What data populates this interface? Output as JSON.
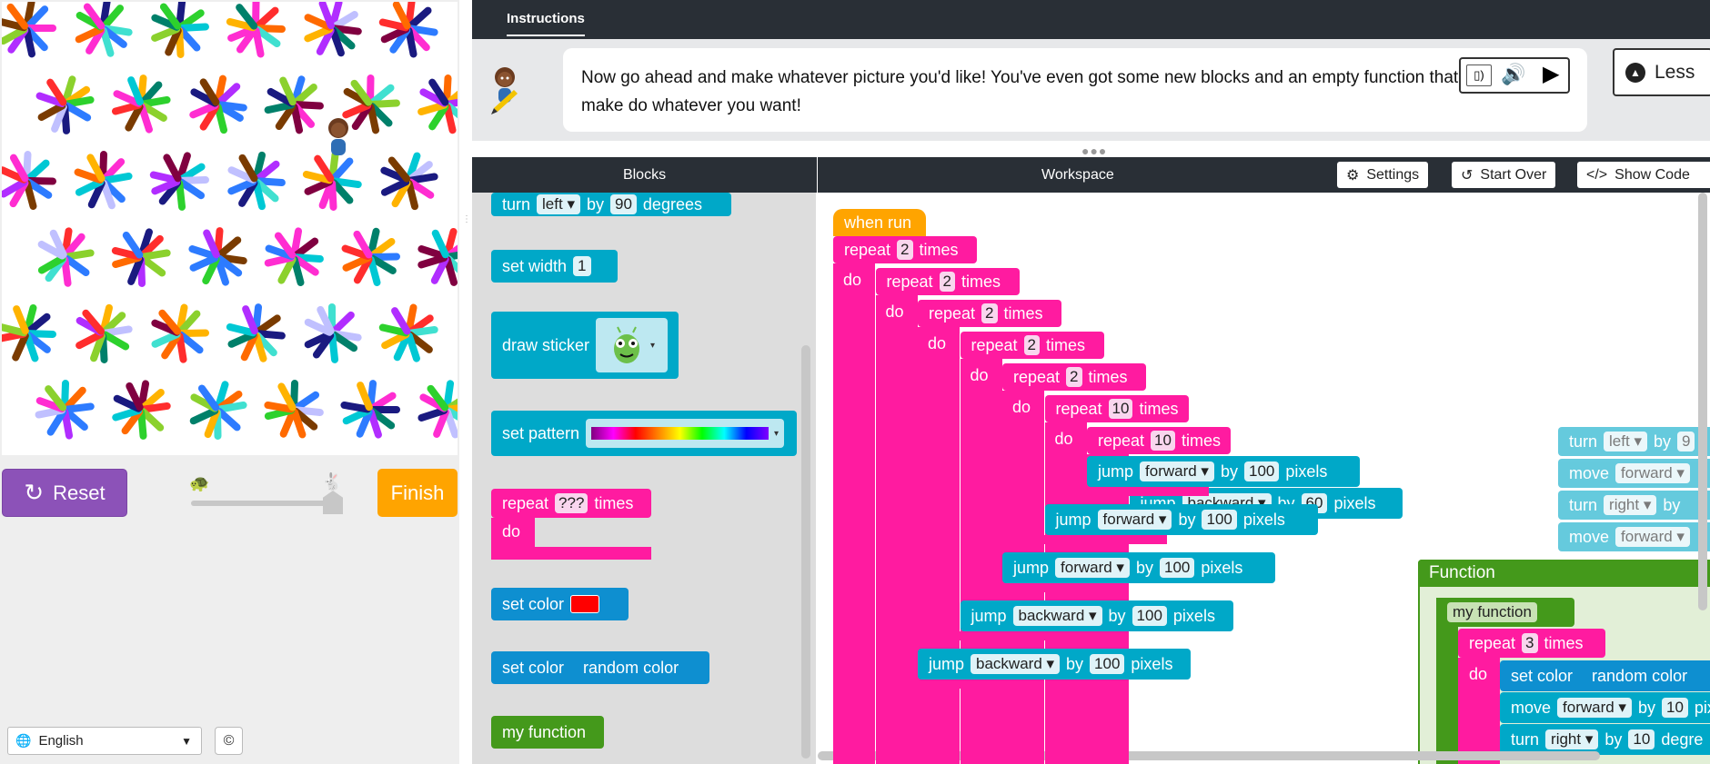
{
  "left_panel": {
    "reset_label": "Reset",
    "finish_label": "Finish",
    "language": "English",
    "speed_slider_value": 1.0
  },
  "instructions": {
    "tab_label": "Instructions",
    "text": "Now go ahead and make whatever picture you'd like! You've even got some new blocks and an empty function that you can make do whatever you want!",
    "less_label": "Less"
  },
  "headers": {
    "blocks": "Blocks",
    "workspace": "Workspace",
    "settings": "Settings",
    "start_over": "Start Over",
    "show_code": "Show Code"
  },
  "toolbox": {
    "turn": {
      "kw": "turn",
      "dir": "left",
      "by": "by",
      "value": "90",
      "unit": "degrees"
    },
    "set_width": {
      "kw": "set width",
      "value": "1"
    },
    "draw_sticker": {
      "kw": "draw sticker"
    },
    "set_pattern": {
      "kw": "set pattern"
    },
    "repeat": {
      "kw": "repeat",
      "value": "???",
      "unit": "times",
      "do": "do"
    },
    "set_color": {
      "kw": "set color",
      "color": "#ff0000"
    },
    "set_color_random": {
      "kw": "set color",
      "value": "random color"
    },
    "my_function": {
      "kw": "my function"
    }
  },
  "workspace": {
    "when_run": "when run",
    "repeat_label": "repeat",
    "times_label": "times",
    "do_label": "do",
    "repeats": [
      "2",
      "2",
      "2",
      "2",
      "2",
      "10",
      "10"
    ],
    "call_label": "my function",
    "jumps": [
      {
        "kw": "jump",
        "dir": "backward",
        "by": "by",
        "value": "60",
        "unit": "pixels"
      },
      {
        "kw": "jump",
        "dir": "forward",
        "by": "by",
        "value": "100",
        "unit": "pixels"
      },
      {
        "kw": "jump",
        "dir": "forward",
        "by": "by",
        "value": "100",
        "unit": "pixels"
      },
      {
        "kw": "jump",
        "dir": "forward",
        "by": "by",
        "value": "100",
        "unit": "pixels"
      },
      {
        "kw": "jump",
        "dir": "backward",
        "by": "by",
        "value": "100",
        "unit": "pixels"
      },
      {
        "kw": "jump",
        "dir": "backward",
        "by": "by",
        "value": "100",
        "unit": "pixels"
      }
    ],
    "side_stack": [
      {
        "kw": "turn",
        "dir": "left",
        "by": "by",
        "value": "9"
      },
      {
        "kw": "move",
        "dir": "forward"
      },
      {
        "kw": "turn",
        "dir": "right",
        "by": "by"
      },
      {
        "kw": "move",
        "dir": "forward"
      }
    ],
    "function_def": {
      "title": "Function",
      "name": "my function",
      "repeat_value": "3",
      "set_color": "set color",
      "random_color": "random color",
      "move": {
        "kw": "move",
        "dir": "forward",
        "by": "by",
        "value": "10",
        "unit": "pix"
      },
      "turn": {
        "kw": "turn",
        "dir": "right",
        "by": "by",
        "value": "10",
        "unit": "degre"
      }
    }
  },
  "colors": {
    "teal": "#00a8c8",
    "blue": "#0e8fd0",
    "pink": "#ff1ba0",
    "green": "#44991b",
    "orange": "#ffa400",
    "purple": "#8c52b8"
  }
}
